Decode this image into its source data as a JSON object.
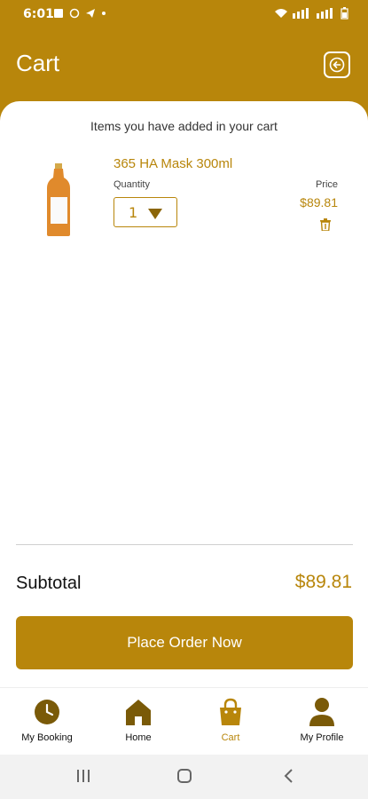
{
  "status": {
    "time": "6:01"
  },
  "header": {
    "title": "Cart"
  },
  "cart": {
    "subtitle": "Items you have added in your cart",
    "item": {
      "name": "365 HA Mask 300ml",
      "quantity_label": "Quantity",
      "quantity": "1",
      "price_label": "Price",
      "price": "$89.81"
    }
  },
  "summary": {
    "subtotal_label": "Subtotal",
    "subtotal_value": "$89.81"
  },
  "actions": {
    "place_order": "Place Order Now"
  },
  "nav": {
    "items": [
      {
        "label": "My Booking",
        "icon": "clock-icon"
      },
      {
        "label": "Home",
        "icon": "home-icon"
      },
      {
        "label": "Cart",
        "icon": "shopping-bag-icon"
      },
      {
        "label": "My Profile",
        "icon": "person-icon"
      }
    ],
    "active": "Cart"
  },
  "colors": {
    "accent": "#B8860B",
    "dark_accent": "#8B6508",
    "background": "#ffffff"
  }
}
